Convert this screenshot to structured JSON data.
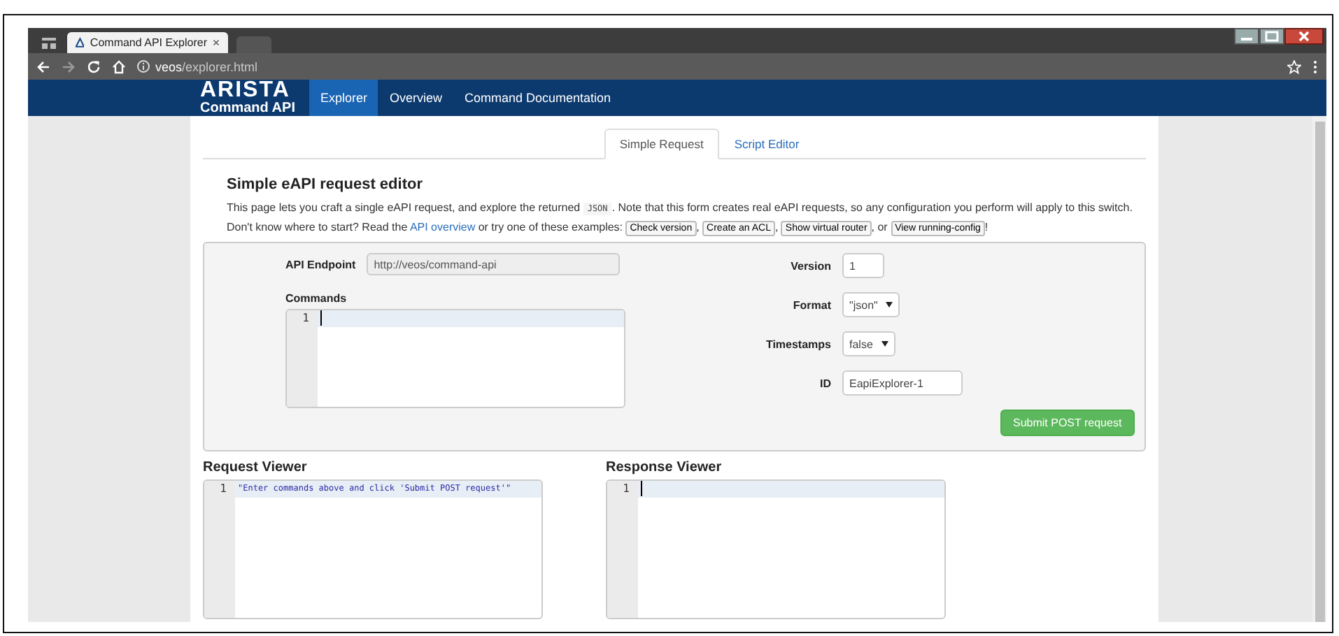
{
  "browser": {
    "tab_title": "Command API Explorer",
    "address_host": "veos",
    "address_path": "/explorer.html"
  },
  "navbar": {
    "brand": "ARISTA",
    "brand_sub": "Command API",
    "items": [
      {
        "label": "Explorer",
        "selected": true
      },
      {
        "label": "Overview",
        "selected": false
      },
      {
        "label": "Command Documentation",
        "selected": false
      }
    ]
  },
  "tabs": [
    {
      "label": "Simple Request",
      "selected": true
    },
    {
      "label": "Script Editor",
      "selected": false
    }
  ],
  "heading": "Simple eAPI request editor",
  "intro": [
    {
      "kind": "text",
      "text": "This page lets you craft a single eAPI request, and explore the returned "
    },
    {
      "kind": "code",
      "text": "JSON"
    },
    {
      "kind": "text",
      "text": ". Note that this form creates real eAPI requests, so any configuration you perform will apply to this switch. Don't know where to start? Read the "
    },
    {
      "kind": "link",
      "text": "API overview"
    },
    {
      "kind": "text",
      "text": " or try one of these examples: "
    },
    {
      "kind": "button",
      "text": "Check version"
    },
    {
      "kind": "text",
      "text": ", "
    },
    {
      "kind": "button",
      "text": "Create an ACL"
    },
    {
      "kind": "text",
      "text": ", "
    },
    {
      "kind": "button",
      "text": "Show virtual router"
    },
    {
      "kind": "text",
      "text": ", or "
    },
    {
      "kind": "button",
      "text": "View running-config"
    },
    {
      "kind": "text",
      "text": "!"
    }
  ],
  "form": {
    "endpoint": {
      "label": "API Endpoint",
      "value": "http://veos/command-api",
      "disabled": true
    },
    "commands": {
      "label": "Commands",
      "lines": [
        {
          "number": "1"
        }
      ]
    },
    "fields": [
      {
        "kind": "input",
        "label": "Version",
        "value": "1"
      },
      {
        "kind": "select",
        "label": "Format",
        "value": "\"json\""
      },
      {
        "kind": "select",
        "label": "Timestamps",
        "value": "false"
      },
      {
        "kind": "input",
        "label": "ID",
        "value": "EapiExplorer-1"
      }
    ],
    "submit": "Submit POST request"
  },
  "viewers": [
    {
      "title": "Request Viewer",
      "lines": [
        {
          "number": "1",
          "text": "\"Enter commands above and click 'Submit POST request'\""
        }
      ]
    },
    {
      "title": "Response Viewer",
      "lines": [
        {
          "number": "1"
        }
      ]
    }
  ]
}
